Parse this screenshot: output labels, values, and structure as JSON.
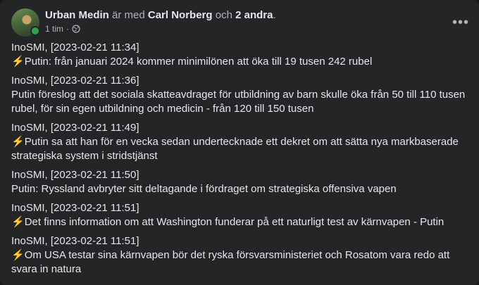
{
  "post": {
    "author": "Urban Medin",
    "with_text": "är med",
    "tagged": "Carl Norberg",
    "and_text": "och",
    "others": "2 andra",
    "period": ".",
    "time": "1 tim",
    "separator": "·",
    "audience_icon": "globe-icon",
    "more_label": "•••"
  },
  "entries": [
    {
      "source": "InoSMI, [2023-02-21 11:34]",
      "icon": "⚡",
      "text": "Putin: från januari 2024 kommer minimilönen att öka till 19 tusen 242 rubel"
    },
    {
      "source": "InoSMI, [2023-02-21 11:36]",
      "icon": "",
      "text": "Putin föreslog att det sociala skatteavdraget för utbildning av barn skulle öka från 50 till 110 tusen rubel, för sin egen utbildning och medicin - från 120 till 150 tusen"
    },
    {
      "source": "InoSMI, [2023-02-21 11:49]",
      "icon": "⚡",
      "text": "Putin sa att han för en vecka sedan undertecknade ett dekret om att sätta nya markbaserade strategiska system i stridstjänst"
    },
    {
      "source": "InoSMI, [2023-02-21 11:50]",
      "icon": "",
      "text": "Putin: Ryssland avbryter sitt deltagande i fördraget om strategiska offensiva vapen"
    },
    {
      "source": "InoSMI, [2023-02-21 11:51]",
      "icon": "⚡",
      "text": "Det finns information om att Washington funderar på ett naturligt test av kärnvapen - Putin"
    },
    {
      "source": "InoSMI, [2023-02-21 11:51]",
      "icon": "⚡",
      "text": "Om USA testar sina kärnvapen bör det ryska försvarsministeriet och Rosatom vara redo att svara in natura"
    }
  ],
  "colors": {
    "card": "#242526",
    "text": "#e4e6eb",
    "muted": "#b0b3b8",
    "online": "#31a24c",
    "bolt": "#f7b928"
  }
}
